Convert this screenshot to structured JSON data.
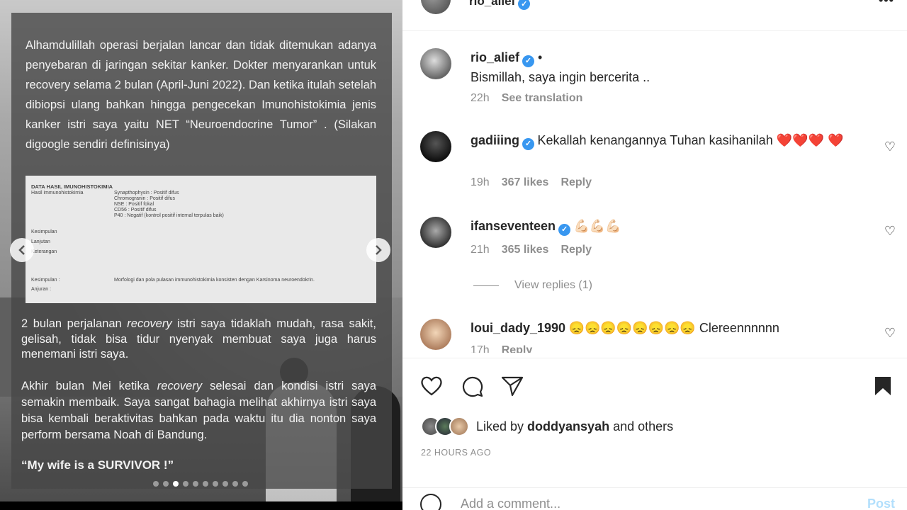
{
  "post": {
    "paragraph1": "Alhamdulillah operasi berjalan lancar dan tidak ditemukan adanya penyebaran di jaringan sekitar kanker. Dokter menyarankan untuk recovery selama 2 bulan (April-Juni 2022). Dan ketika itulah setelah dibiopsi ulang bahkan hingga pengecekan Imunohistokimia jenis kanker istri saya yaitu NET “Neuroendocrine Tumor”    . (Silakan digoogle sendiri definisinya)",
    "doc": {
      "title": "DATA HASIL IMUNOHISTOKIMIA",
      "hasil_label": "Hasil immunohistokimia",
      "results": [
        "Synapthophysin : Positif difus",
        "Chromogranin : Positif difus",
        "NSE : Positif fokal",
        "CD56 : Positif difus",
        "P40 : Negatif (kontrol positif internal terpulas baik)"
      ],
      "kesimpulan_label": "Kesimpulan",
      "lanjutan_label": "Lanjutan",
      "keterangan_label": "Keterangan",
      "kesimpulan2_label": "Kesimpulan :",
      "kesimpulan2_text": "Morfologi dan pola pulasan immunohistokimia konsisten dengan Karsinoma neuroendokrin.",
      "anjuran_label": "Anjuran :"
    },
    "paragraph2_a": "2 bulan perjalanan ",
    "paragraph2_em": "recovery",
    "paragraph2_b": " istri saya tidaklah mudah, rasa sakit, gelisah, tidak bisa tidur nyenyak membuat saya juga harus menemani istri saya.",
    "paragraph3_a": "Akhir bulan Mei ketika ",
    "paragraph3_em": "recovery",
    "paragraph3_b": " selesai dan kondisi istri  saya semakin membaik. Saya sangat bahagia melihat akhirnya istri saya bisa kembali  beraktivitas bahkan pada waktu itu dia nonton saya perform bersama Noah di Bandung.",
    "paragraph4": "“My wife is a SURVIVOR !”",
    "carousel_total": 10,
    "carousel_active": 3
  },
  "header": {
    "username": "rio_alief",
    "more": "•••"
  },
  "caption": {
    "username": "rio_alief",
    "dot": " •",
    "text": "Bismillah, saya ingin bercerita ..",
    "time": "22h",
    "see_translation": "See translation"
  },
  "comments": [
    {
      "username": "gadiiing",
      "text": "Kekallah kenangannya Tuhan kasihanilah ❤️❤️❤️ ❤️",
      "time": "19h",
      "likes": "367 likes",
      "reply": "Reply"
    },
    {
      "username": "ifanseventeen",
      "text": "💪🏻💪🏻💪🏻",
      "time": "21h",
      "likes": "365 likes",
      "reply": "Reply",
      "view_replies": "View replies (1)"
    },
    {
      "username": "loui_dady_1990",
      "text": "😞😞😞😞😞😞😞😞 Clereennnnnn",
      "time": "17h",
      "reply": "Reply"
    }
  ],
  "liked_by": {
    "prefix": "Liked by ",
    "user": "doddyansyah",
    "suffix": " and others"
  },
  "timestamp": "22 HOURS AGO",
  "add_comment": {
    "placeholder": "Add a comment...",
    "post_label": "Post"
  },
  "icons": [
    "heart-icon",
    "comment-icon",
    "share-icon",
    "bookmark-icon",
    "emoji-icon",
    "chevron-left-icon",
    "chevron-right-icon",
    "verified-icon",
    "more-icon"
  ],
  "colors": {
    "verified": "#3897f0",
    "muted": "#8e8e8e",
    "post_disabled": "#b2dffc"
  }
}
